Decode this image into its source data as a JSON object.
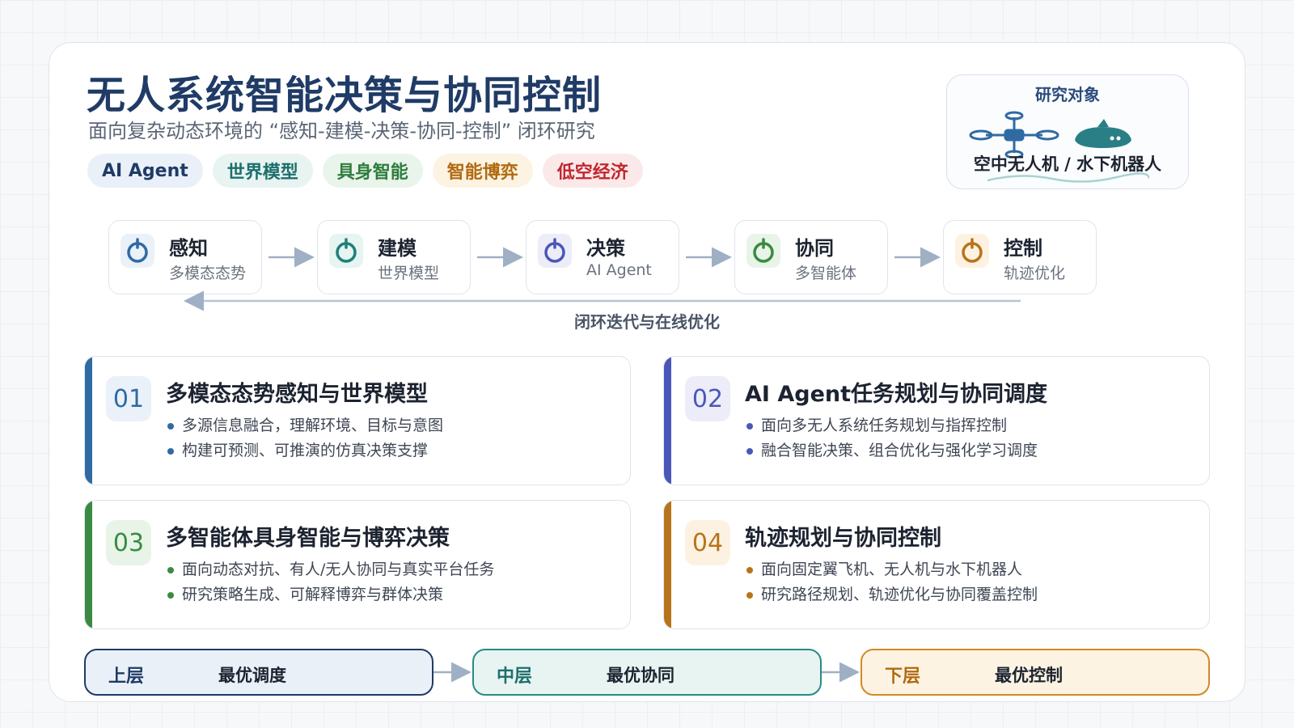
{
  "title": "无人系统智能决策与协同控制",
  "subtitle": "面向复杂动态环境的 “感知-建模-决策-协同-控制” 闭环研究",
  "tags": [
    {
      "label": "AI Agent",
      "color": "#1f3b66",
      "bg": "#eaf0f8"
    },
    {
      "label": "世界模型",
      "color": "#1d6f6c",
      "bg": "#e7f4f2"
    },
    {
      "label": "具身智能",
      "color": "#2e7d3e",
      "bg": "#e9f4ea"
    },
    {
      "label": "智能博弈",
      "color": "#b06a10",
      "bg": "#fdf3e2"
    },
    {
      "label": "低空经济",
      "color": "#c0262d",
      "bg": "#fbe9ea"
    }
  ],
  "research_target": {
    "label": "研究对象",
    "caption": "空中无人机 / 水下机器人",
    "icons": [
      "drone-icon",
      "submarine-icon"
    ]
  },
  "pipeline": {
    "stages": [
      {
        "name": "感知",
        "sub": "多模态态势",
        "color": "#2f6aa3",
        "bg": "#eaf1f9"
      },
      {
        "name": "建模",
        "sub": "世界模型",
        "color": "#1f807a",
        "bg": "#e6f4f2"
      },
      {
        "name": "决策",
        "sub": "AI Agent",
        "color": "#4a57b8",
        "bg": "#ecedf9"
      },
      {
        "name": "协同",
        "sub": "多智能体",
        "color": "#3a8a43",
        "bg": "#e8f4e8"
      },
      {
        "name": "控制",
        "sub": "轨迹优化",
        "color": "#b8741a",
        "bg": "#fdf2e2"
      }
    ],
    "loop_label": "闭环迭代与在线优化"
  },
  "topics": [
    {
      "num": "01",
      "title": "多模态态势感知与世界模型",
      "color": "#2f6aa3",
      "bg": "#eaf1f9",
      "points": [
        "多源信息融合，理解环境、目标与意图",
        "构建可预测、可推演的仿真决策支撑"
      ]
    },
    {
      "num": "02",
      "title": "AI Agent任务规划与协同调度",
      "color": "#4a57b8",
      "bg": "#ecedf9",
      "points": [
        "面向多无人系统任务规划与指挥控制",
        "融合智能决策、组合优化与强化学习调度"
      ]
    },
    {
      "num": "03",
      "title": "多智能体具身智能与博弈决策",
      "color": "#3a8a43",
      "bg": "#e8f4e8",
      "points": [
        "面向动态对抗、有人/无人协同与真实平台任务",
        "研究策略生成、可解释博弈与群体决策"
      ]
    },
    {
      "num": "04",
      "title": "轨迹规划与协同控制",
      "color": "#b8741a",
      "bg": "#fdf2e2",
      "points": [
        "面向固定翼飞机、无人机与水下机器人",
        "研究路径规划、轨迹优化与协同覆盖控制"
      ]
    }
  ],
  "layers": [
    {
      "name": "上层",
      "desc": "最优调度",
      "color": "#1f3b66",
      "border": "#1f3b66",
      "bg": "#e9f0f8"
    },
    {
      "name": "中层",
      "desc": "最优协同",
      "color": "#1d6f6c",
      "border": "#2a8a84",
      "bg": "#e8f4f2"
    },
    {
      "name": "下层",
      "desc": "最优控制",
      "color": "#b06a10",
      "border": "#d08a2a",
      "bg": "#fdf3e2"
    }
  ]
}
